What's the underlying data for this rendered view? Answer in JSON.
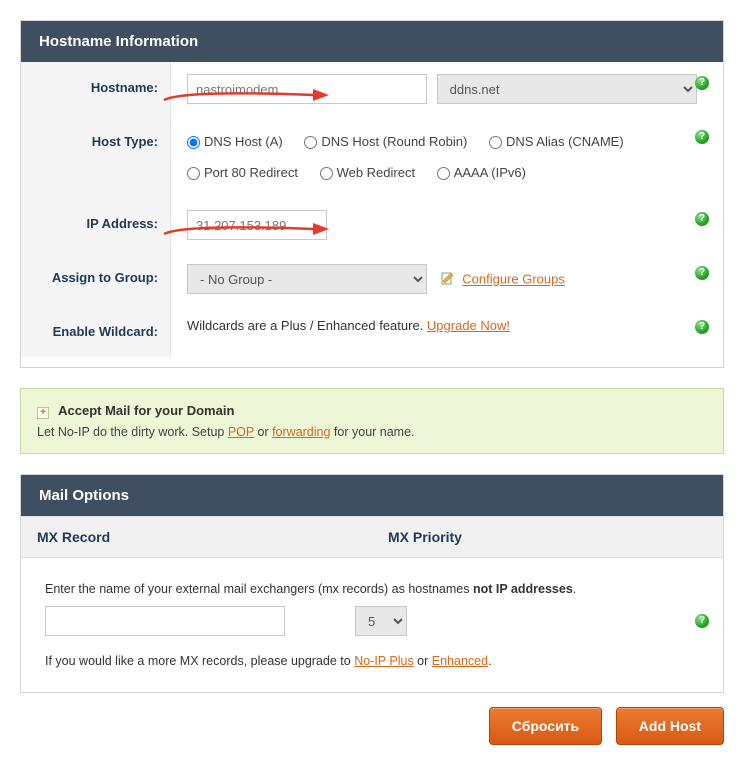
{
  "hostname_panel": {
    "title": "Hostname Information",
    "labels": {
      "hostname": "Hostname:",
      "host_type": "Host Type:",
      "ip_address": "IP Address:",
      "assign_group": "Assign to Group:",
      "enable_wildcard": "Enable Wildcard:"
    },
    "hostname_value": "nastroimodem",
    "domain_selected": "ddns.net",
    "host_type_options": {
      "a": "DNS Host (A)",
      "rr": "DNS Host (Round Robin)",
      "cname": "DNS Alias (CNAME)",
      "p80": "Port 80 Redirect",
      "web": "Web Redirect",
      "aaaa": "AAAA (IPv6)"
    },
    "host_type_selected": "a",
    "ip_value": "31.207.153.189",
    "group_selected": "- No Group -",
    "configure_groups_label": "Configure Groups",
    "wildcard_text": "Wildcards are a Plus / Enhanced feature. ",
    "wildcard_upgrade_label": "Upgrade Now!"
  },
  "mail_info": {
    "title": "Accept Mail for your Domain",
    "line_prefix": "Let No-IP do the dirty work. Setup ",
    "pop": "POP",
    "mid": " or ",
    "fwd": "forwarding",
    "suffix": " for your name."
  },
  "mail_panel": {
    "title": "Mail Options",
    "col_record": "MX Record",
    "col_priority": "MX Priority",
    "intro_prefix": "Enter the name of your external mail exchangers (mx records) as hostnames ",
    "intro_bold": "not IP addresses",
    "intro_suffix": ".",
    "mx_value": "",
    "priority_selected": "5",
    "more_prefix": "If you would like a more MX records, please upgrade to ",
    "noip_plus": "No-IP Plus",
    "more_mid": " or ",
    "enhanced": "Enhanced",
    "more_suffix": "."
  },
  "buttons": {
    "reset": "Сбросить",
    "add": "Add Host"
  }
}
